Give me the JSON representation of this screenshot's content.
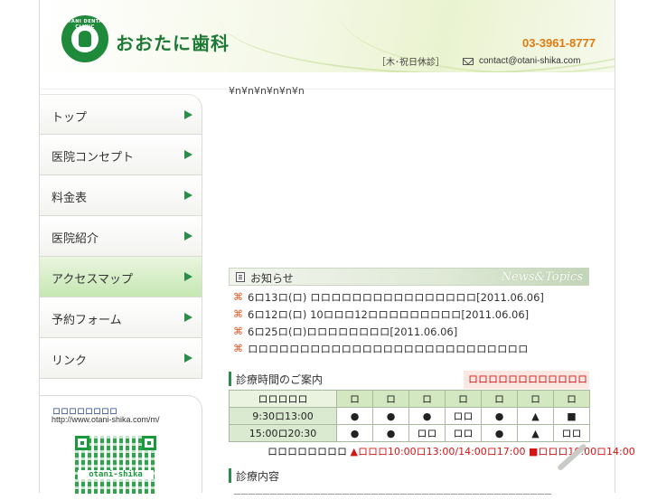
{
  "header": {
    "clinic_name": "おおたに歯科",
    "logo_ring_text": "OTANI DENTAL CLINIC",
    "phone": "03-3961-8777",
    "closed_days": "［木･祝日休診］",
    "email": "contact@otani-shika.com"
  },
  "stray_text": "¥n¥n¥n¥n¥n¥n",
  "nav": {
    "items": [
      {
        "label": "トップ"
      },
      {
        "label": "医院コンセプト"
      },
      {
        "label": "料金表"
      },
      {
        "label": "医院紹介"
      },
      {
        "label": "アクセスマップ"
      },
      {
        "label": "予約フォーム"
      },
      {
        "label": "リンク"
      }
    ]
  },
  "mobile": {
    "title": "ロロロロロロロロ",
    "url": "http://www.otani-shika.com/m/",
    "qr_text": "otani-shika"
  },
  "news": {
    "title": "お知らせ",
    "title_en": "News&Topics",
    "items": [
      {
        "text": "6ロ13ロ(ロ) ロロロロロロロロロロロロロロロロ[2011.06.06]"
      },
      {
        "text": "6ロ12ロ(ロ) 10ロロロ12ロロロロロロロロロ[2011.06.06]"
      },
      {
        "text": "6ロ25ロ(ロ)ロロロロロロロロ[2011.06.06]"
      },
      {
        "text": "ロロロロロロロロロロロロロロロロロロロロロロロロロロロ"
      }
    ]
  },
  "hours": {
    "title": "診療時間のご案内",
    "note": "ロロロロロロロロロロロロロ",
    "header": [
      "ロロロロロ",
      "ロ",
      "ロ",
      "ロ",
      "ロ",
      "ロ",
      "ロ",
      "ロ"
    ],
    "rows": [
      {
        "time": "9:30ロ13:00",
        "cells": [
          "●",
          "●",
          "●",
          "ロロ",
          "●",
          "▲",
          "■"
        ]
      },
      {
        "time": "15:00ロ20:30",
        "cells": [
          "●",
          "●",
          "ロロ",
          "ロロ",
          "●",
          "▲",
          "ロロ"
        ]
      }
    ],
    "legend_plain": "ロロロロロロロロ",
    "legend_triangle": "▲ロロロ10:00ロ13:00/14:00ロ17:00",
    "legend_square": "■ロロロ10:00ロ14:00"
  },
  "services": {
    "title": "診療内容",
    "underline_text": "ーーーーーーーーーーーーーーーーーーーーーーーーーーーーーーーーーーーーーーーーーーーー"
  },
  "colors": {
    "brand_green": "#1d7a35",
    "phone_orange": "#e07a10",
    "nav_arrow": "#2a8d4a",
    "alert_red": "#d41515"
  }
}
